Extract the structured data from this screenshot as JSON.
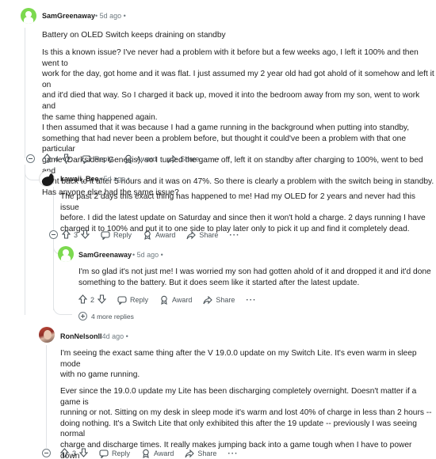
{
  "colors": {
    "accent_green": "#7cd94f",
    "text": "#1c1c1c",
    "muted": "#6f7a80",
    "thread": "#e0e3e6"
  },
  "comments": [
    {
      "username": "SamGreenaway",
      "meta": "• 5d ago •",
      "title": "Battery on OLED Switch keeps draining on standby",
      "body": "Is this a known issue? I've never had a problem with it before but a few weeks ago, I left it 100% and then went to\nwork for the day, got home and it was flat. I just assumed my 2 year old had got ahold of it somehow and left it on\nand it'd died that way. So I charged it back up, moved it into the bedroom away from my son, went to work and\nthe same thing happened again.\nI then assumed that it was because I had a game running in the background when putting into standby,\nsomething that had never been a problem before, but thought it could've been a problem with that one particular\ngame (Darksiders Genesis), so I turned the game off, left it on standby after charging to 100%, went to bed and\nwent back to it after 5 hours and it was on 47%. So there is clearly a problem with the switch being in standby.\nHas anyone else had the same issue?",
      "votes": "4",
      "avatar_icon": "snoo-avatar-icon"
    },
    {
      "username": "kawaii_Bee",
      "meta": "• 5d ago •",
      "body": "The past 2 days this exact thing has happened to me! Had my OLED for 2 years and never had this issue\nbefore. I did the latest update on Saturday and since then it won't hold a charge. 2 days running I have\ncharged it to 100% and put it to one side to play later only to pick it up and find it completely dead.",
      "votes": "3",
      "avatar_icon": "bee-avatar-icon"
    },
    {
      "username": "SamGreenaway",
      "meta": "• 5d ago •",
      "body": "I'm so glad it's not just me! I was worried my son had gotten ahold of it and dropped it and it'd done\nsomething to the battery. But it does seem like it started after the latest update.",
      "votes": "2",
      "avatar_icon": "snoo-avatar-icon"
    },
    {
      "username": "RonNelsonII",
      "meta": "• 4d ago •",
      "body": "I'm seeing the exact same thing after the V 19.0.0 update on my Switch Lite. It's even warm in sleep mode\nwith no game running.",
      "body2": "Ever since the 19.0.0 update my Lite has been discharging completely overnight. Doesn't matter if a game is\nrunning or not. Sitting on my desk in sleep mode it's warm and lost 40% of charge in less than 2 hours --\ndoing nothing. It's a Switch Lite that only exhibited this after the 19 update -- previously I was seeing normal\ncharge and discharge times. It really makes jumping back into a game tough when I have to power down\ncompletely.",
      "votes": "3",
      "avatar_icon": "photo-avatar-icon"
    }
  ],
  "actions": {
    "reply": "Reply",
    "award": "Award",
    "share": "Share",
    "more": "···"
  },
  "more_replies": "4 more replies"
}
